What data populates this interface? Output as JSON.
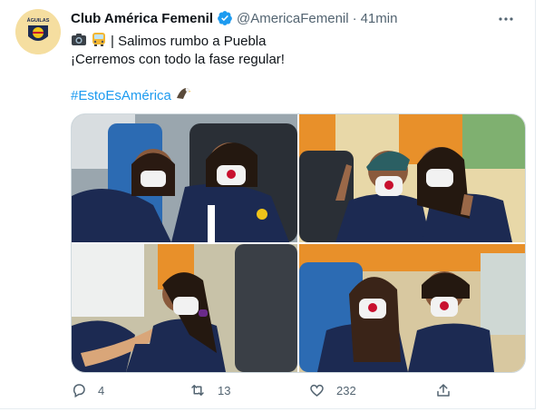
{
  "account": {
    "name": "Club América Femenil",
    "handle": "@AmericaFemenil",
    "separator": "·",
    "time": "41min",
    "avatar_text": "ÁGUILAS"
  },
  "tweet": {
    "line1": "| Salimos rumbo a Puebla",
    "line2": "¡Cerremos con todo la fase regular!",
    "hashtag": "#EstoEsAmérica"
  },
  "photos": [
    {
      "alt_icon": "photo-1"
    },
    {
      "alt_icon": "photo-2"
    },
    {
      "alt_icon": "photo-3"
    },
    {
      "alt_icon": "photo-4"
    }
  ],
  "stats": {
    "replies": "4",
    "retweets": "13",
    "likes": "232"
  },
  "colors": {
    "accent": "#1d9bf0",
    "secondary_text": "#536471",
    "jersey_navy": "#1c2a52",
    "curtain_orange": "#e8902a"
  }
}
